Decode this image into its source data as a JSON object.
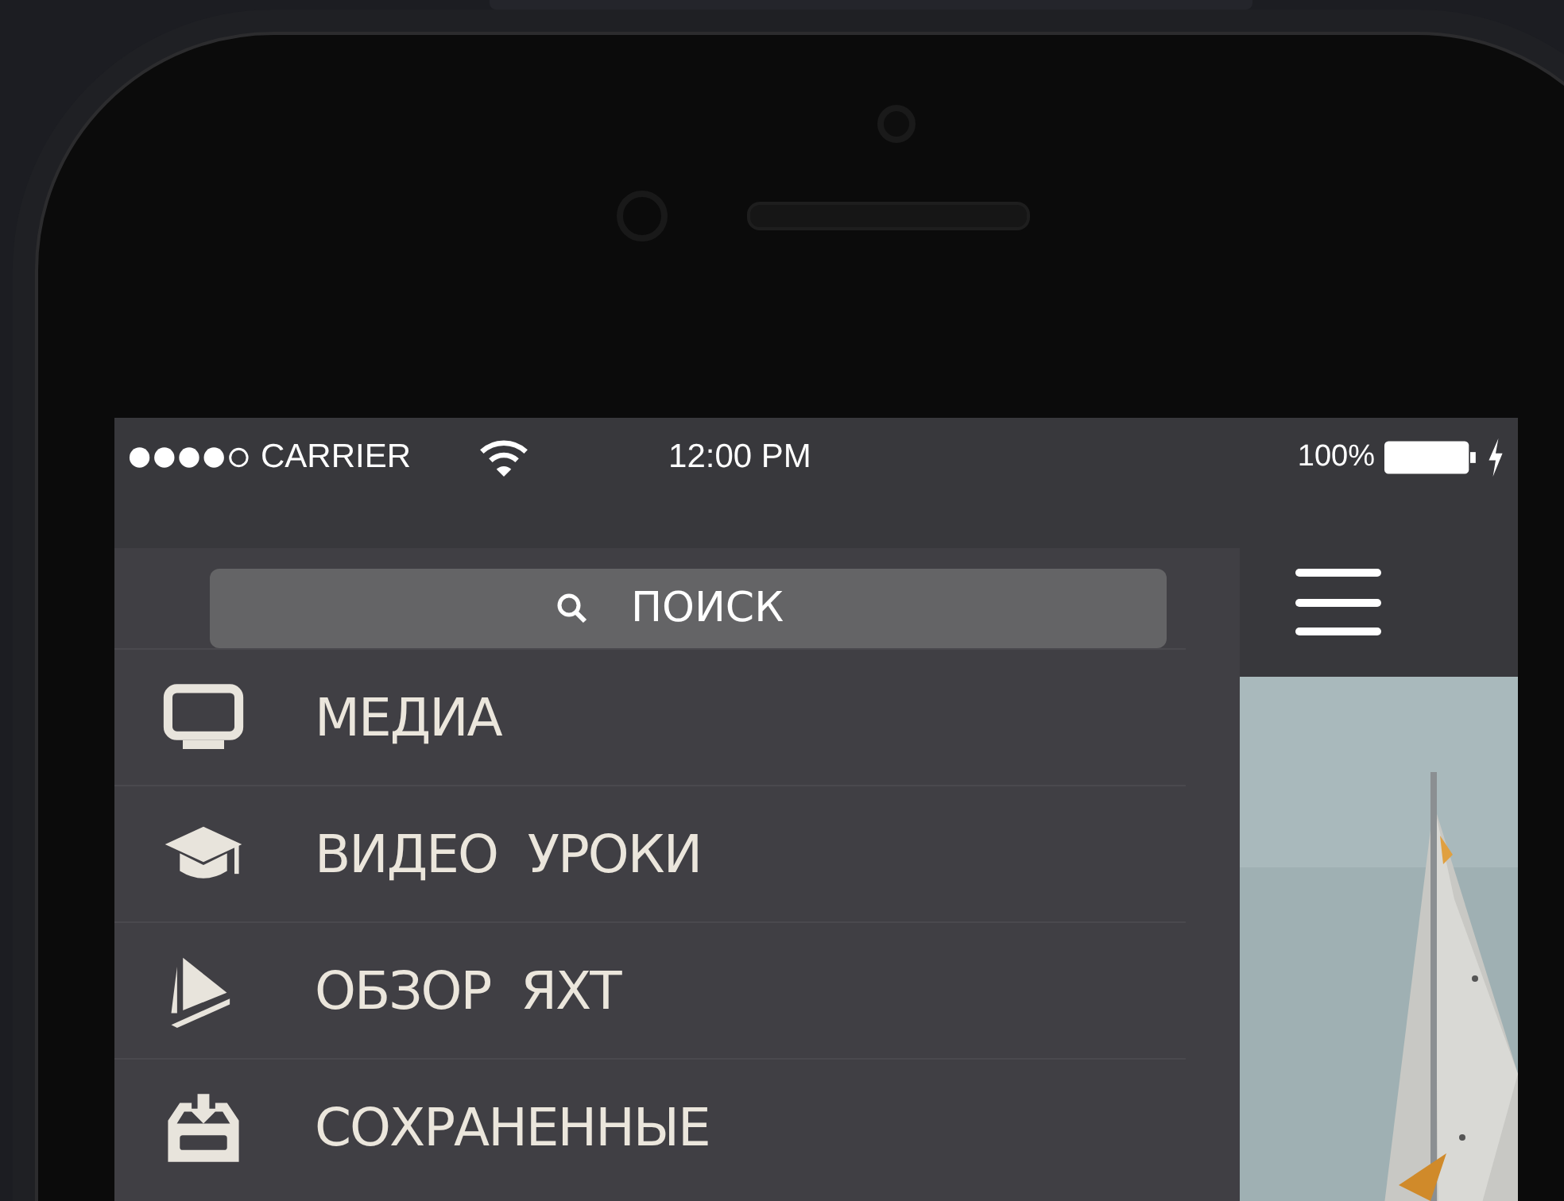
{
  "status_bar": {
    "carrier": "CARRIER",
    "time": "12:00 PM",
    "battery": "100%"
  },
  "search": {
    "placeholder": "ПОИСК"
  },
  "menu": [
    {
      "label": "МЕДИА",
      "kind": "monitor"
    },
    {
      "label": "ВИДЕО  УРОКИ",
      "kind": "cap"
    },
    {
      "label": "ОБЗОР  ЯХТ",
      "kind": "sail"
    },
    {
      "label": "СОХРАНЕННЫЕ",
      "kind": "tray"
    }
  ]
}
